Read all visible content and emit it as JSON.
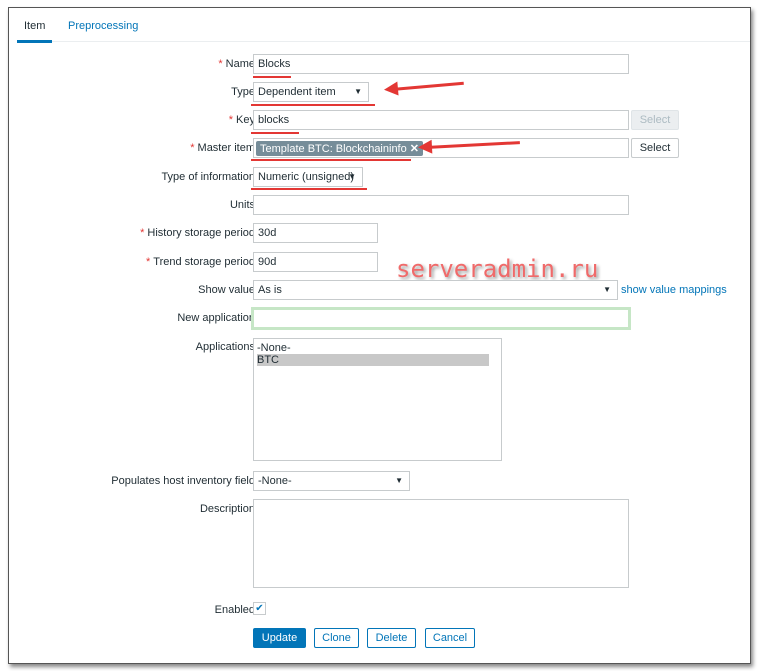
{
  "tabs": [
    "Item",
    "Preprocessing"
  ],
  "fields": {
    "name": {
      "label": "Name",
      "value": "Blocks"
    },
    "type": {
      "label": "Type",
      "value": "Dependent item"
    },
    "key": {
      "label": "Key",
      "value": "blocks",
      "button": "Select"
    },
    "master": {
      "label": "Master item",
      "value": "Template BTC: Blockchaininfo",
      "button": "Select"
    },
    "type_info": {
      "label": "Type of information",
      "value": "Numeric (unsigned)"
    },
    "units": {
      "label": "Units",
      "value": ""
    },
    "history": {
      "label": "History storage period",
      "value": "30d"
    },
    "trend": {
      "label": "Trend storage period",
      "value": "90d"
    },
    "show_value": {
      "label": "Show value",
      "value": "As is",
      "link": "show value mappings"
    },
    "new_app": {
      "label": "New application",
      "value": ""
    },
    "applications": {
      "label": "Applications",
      "options": [
        "-None-",
        "BTC"
      ]
    },
    "inventory": {
      "label": "Populates host inventory field",
      "value": "-None-"
    },
    "description": {
      "label": "Description",
      "value": ""
    },
    "enabled": {
      "label": "Enabled",
      "checked": true
    }
  },
  "buttons": {
    "update": "Update",
    "clone": "Clone",
    "delete": "Delete",
    "cancel": "Cancel"
  },
  "watermark": "serveradmin.ru",
  "required_mark": "*"
}
